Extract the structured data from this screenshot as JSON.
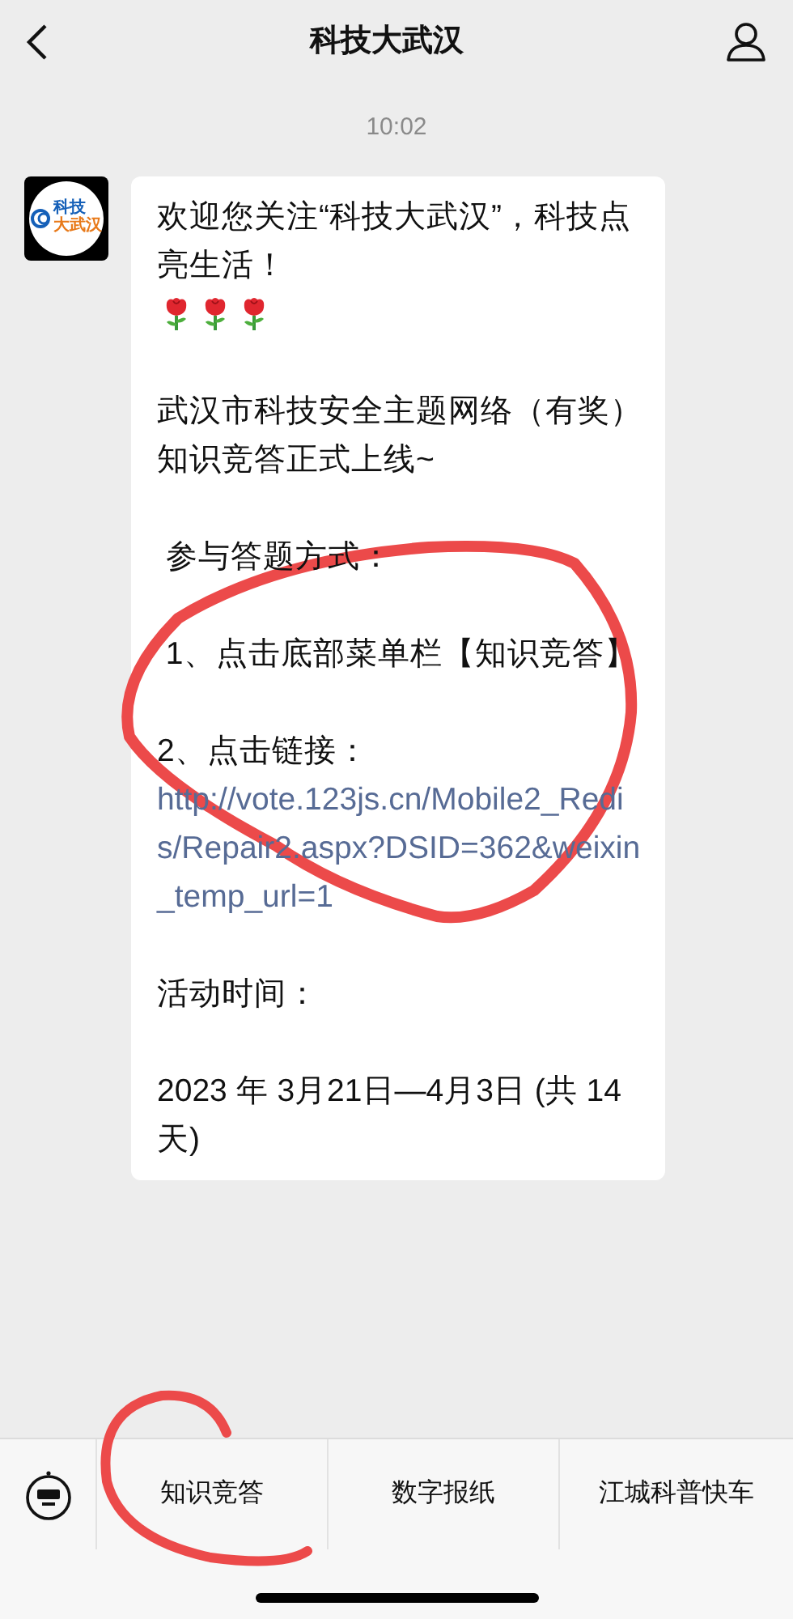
{
  "header": {
    "title": "科技大武汉"
  },
  "timestamp": "10:02",
  "avatar": {
    "line_1": "科技",
    "line_2": "大武汉"
  },
  "message": {
    "paragraphs": [
      {
        "kind": "text",
        "text": "欢迎您关注“科技大武汉”，科技点亮生活！",
        "icons": [
          {
            "kind": "rose"
          },
          {
            "kind": "rose"
          },
          {
            "kind": "rose"
          }
        ]
      },
      {
        "kind": "text",
        "text": "武汉市科技安全主题网络（有奖）知识竞答正式上线~"
      },
      {
        "kind": "text",
        "text": " 参与答题方式："
      },
      {
        "kind": "text",
        "text": " 1、点击底部菜单栏【知识竞答】"
      },
      {
        "kind": "link",
        "text": "2、点击链接：",
        "url": "http://vote.123js.cn/Mobile2_Redis/Repair2.aspx?DSID=362&weixin_temp_url=1"
      },
      {
        "kind": "text",
        "text": "活动时间："
      },
      {
        "kind": "text",
        "text": "2023 年 3月21日—4月3日 (共 14 天)"
      }
    ]
  },
  "menu": {
    "items": [
      "知识竞答",
      "数字报纸",
      "江城科普快车"
    ]
  }
}
